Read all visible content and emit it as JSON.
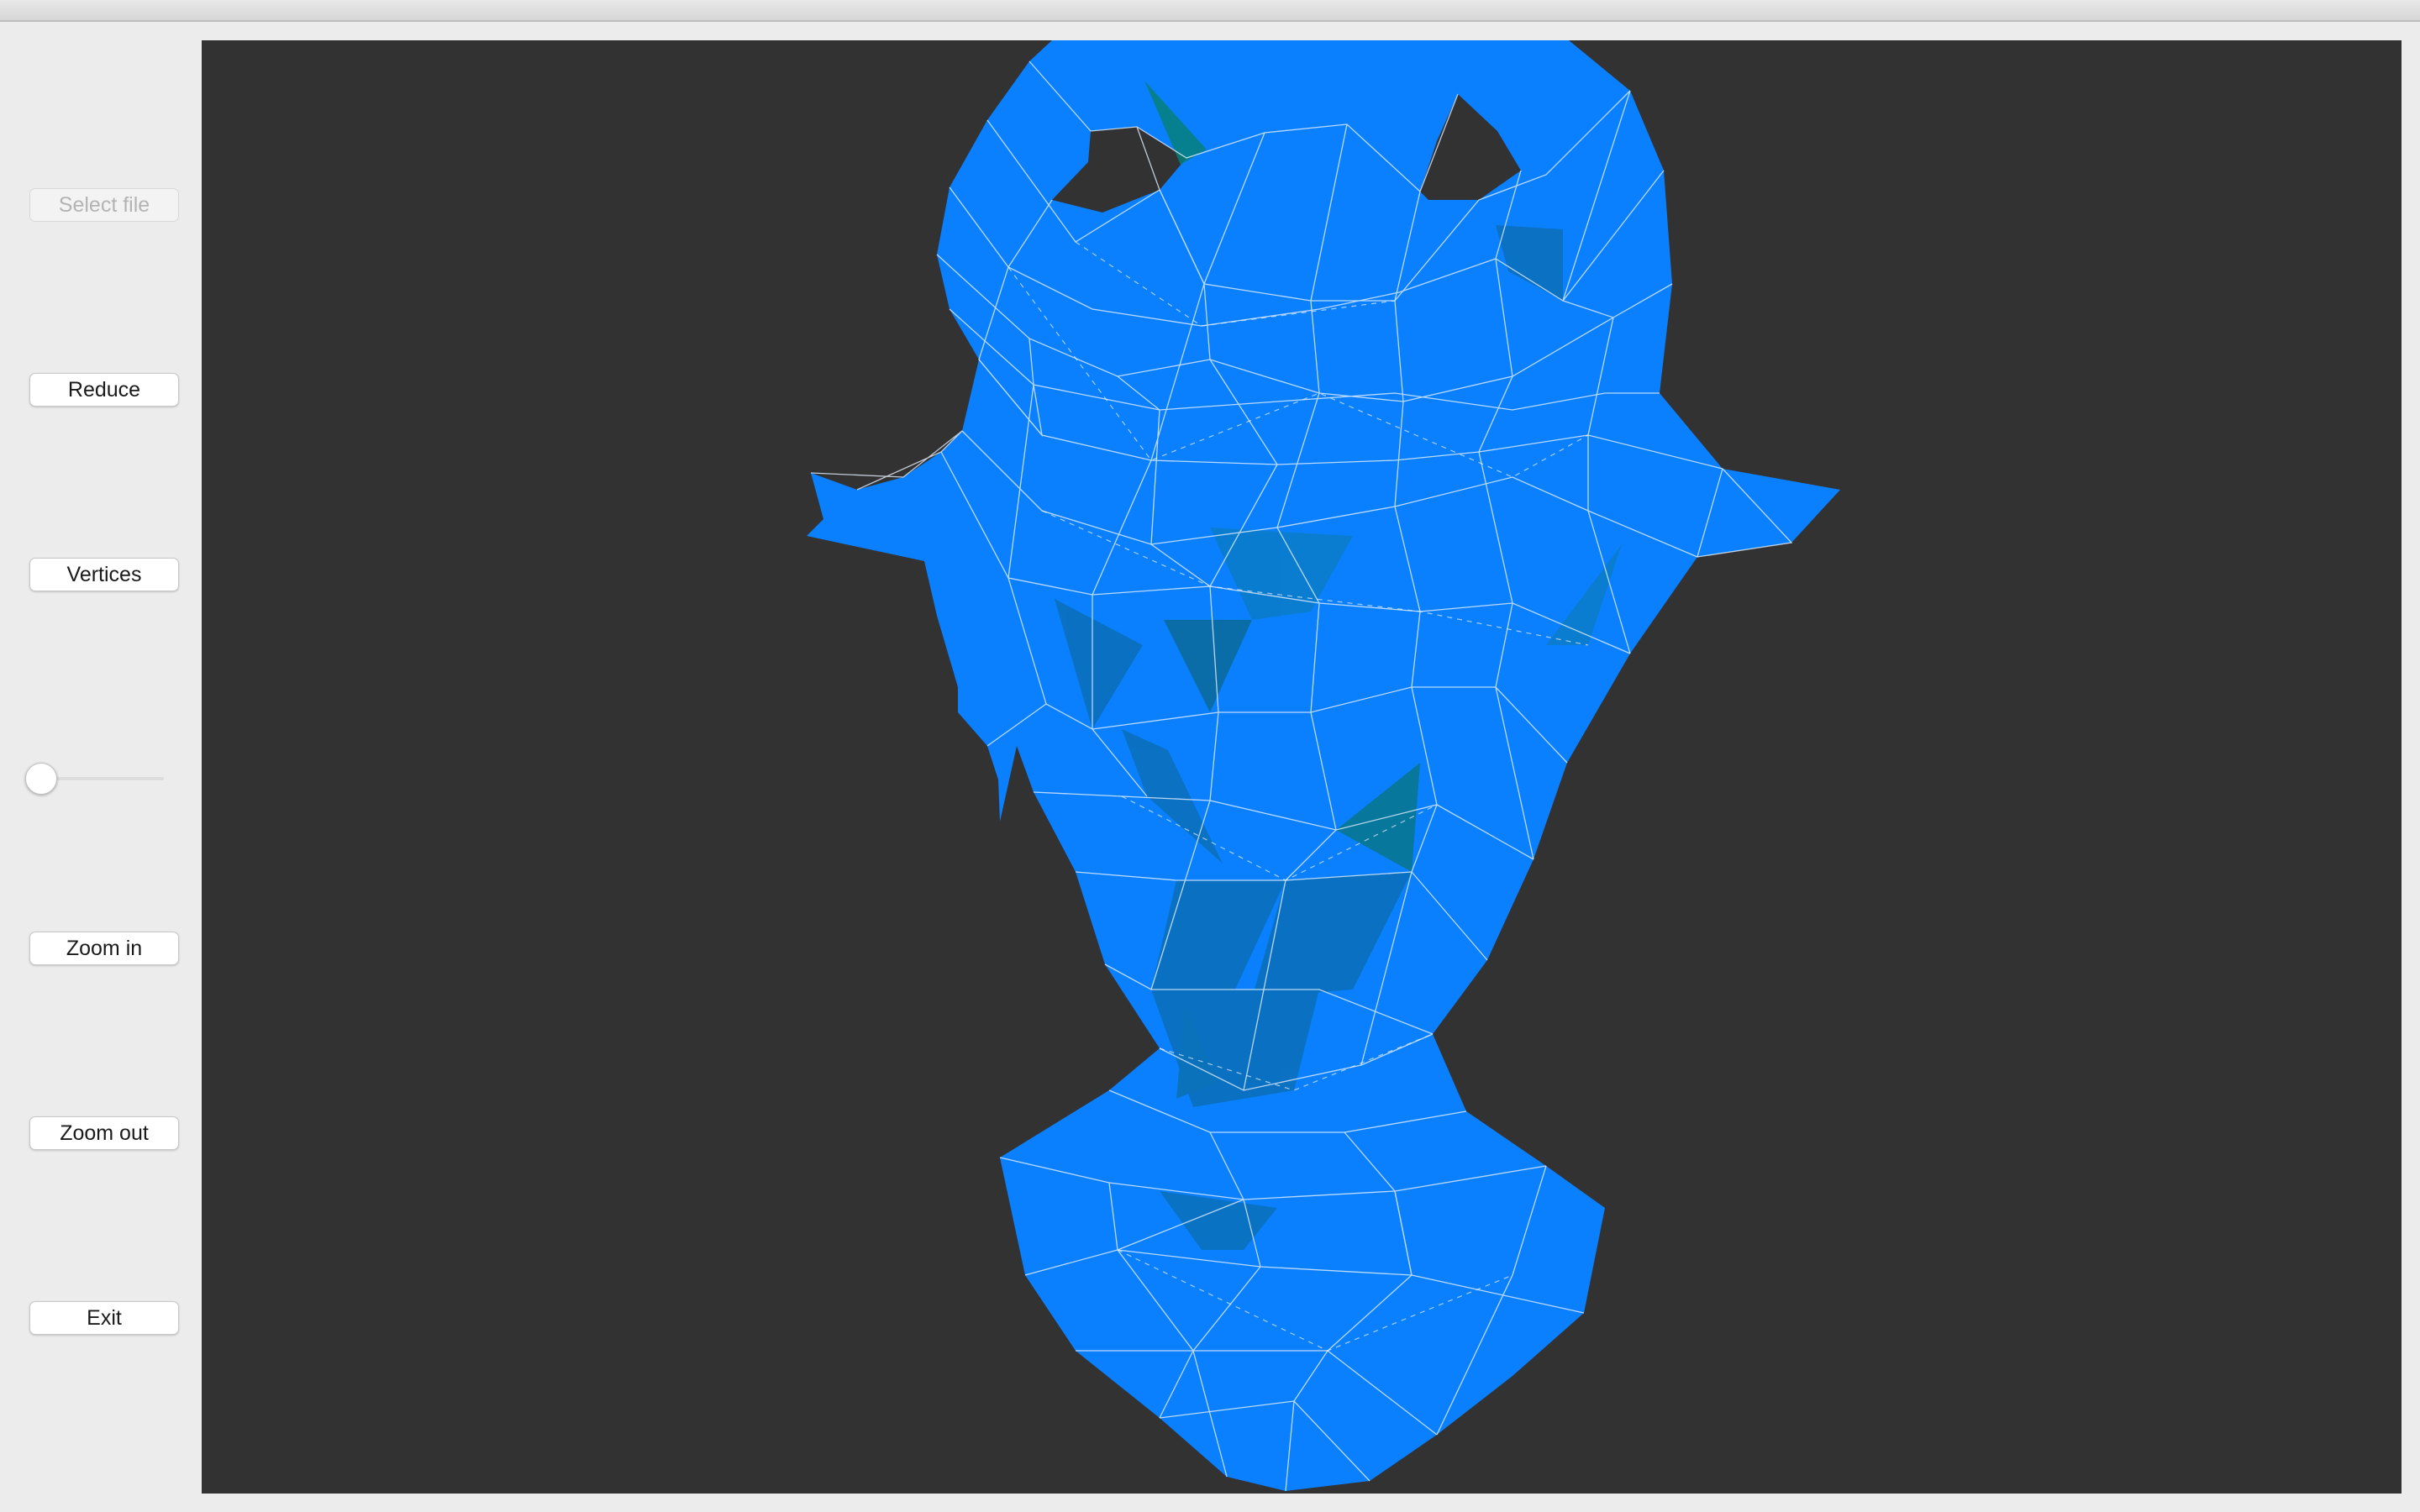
{
  "sidebar": {
    "select_file_label": "Select file",
    "reduce_label": "Reduce",
    "vertices_label": "Vertices",
    "zoom_in_label": "Zoom in",
    "zoom_out_label": "Zoom out",
    "exit_label": "Exit"
  },
  "slider": {
    "value": 0
  },
  "viewport": {
    "background": "#323232",
    "mesh_color": "#0a80ff",
    "mesh_shaded_color": "#0a7ec8",
    "mesh_dark_color": "#06807a",
    "edge_color": "#e6f0ff"
  }
}
